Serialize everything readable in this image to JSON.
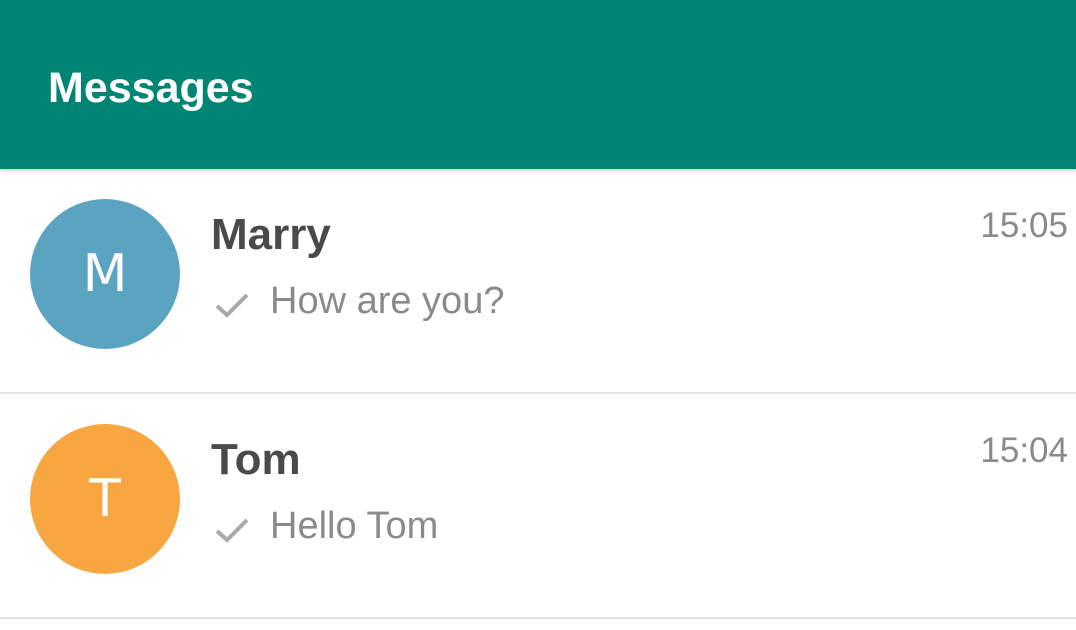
{
  "app_bar": {
    "title": "Messages",
    "color": "#008575"
  },
  "conversations": [
    {
      "avatar_letter": "M",
      "avatar_color": "#5BA4C1",
      "name": "Marry",
      "time": "15:05",
      "status_icon": "check-icon",
      "last_message": "How are you?"
    },
    {
      "avatar_letter": "T",
      "avatar_color": "#F8A641",
      "name": "Tom",
      "time": "15:04",
      "status_icon": "check-icon",
      "last_message": "Hello Tom"
    }
  ]
}
